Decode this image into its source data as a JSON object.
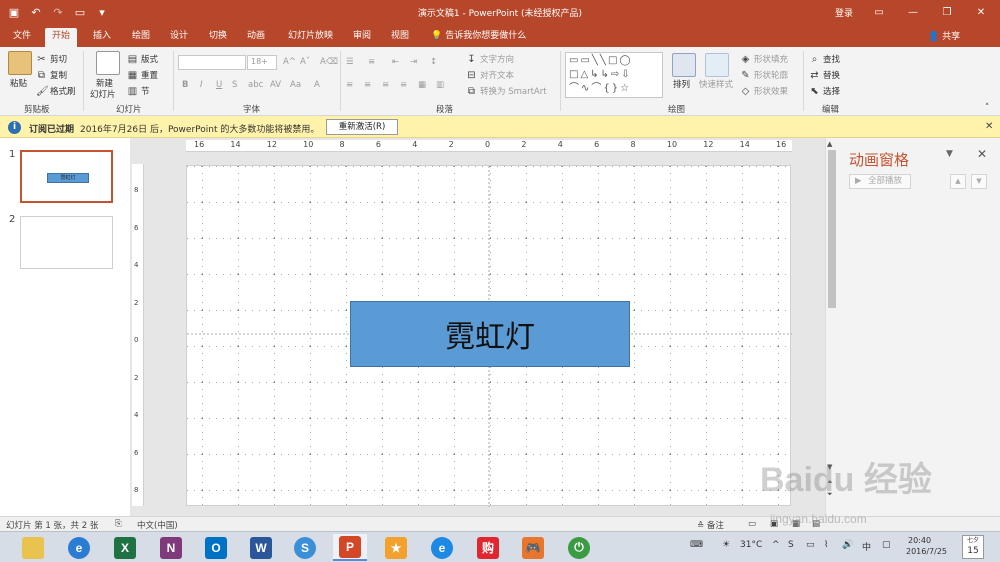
{
  "app": {
    "title": "演示文稿1 - PowerPoint (未经授权产品)",
    "signin": "登录",
    "share": "共享"
  },
  "tabs": [
    {
      "label": "文件"
    },
    {
      "label": "开始"
    },
    {
      "label": "插入"
    },
    {
      "label": "绘图"
    },
    {
      "label": "设计"
    },
    {
      "label": "切换"
    },
    {
      "label": "动画"
    },
    {
      "label": "幻灯片放映"
    },
    {
      "label": "审阅"
    },
    {
      "label": "视图"
    }
  ],
  "tell_me": "告诉我你想要做什么",
  "ribbon": {
    "clipboard": {
      "paste": "粘贴",
      "cut": "剪切",
      "copy": "复制",
      "format_painter": "格式刷",
      "label": "剪贴板"
    },
    "slides": {
      "new_slide": "新建",
      "new_slide2": "幻灯片",
      "layout": "版式",
      "reset": "重置",
      "section": "节",
      "label": "幻灯片"
    },
    "font": {
      "size_value": "18+",
      "label": "字体"
    },
    "paragraph": {
      "text_direction": "文字方向",
      "align_text": "对齐文本",
      "convert_smartart": "转换为 SmartArt",
      "label": "段落"
    },
    "drawing": {
      "arrange": "排列",
      "quick_styles": "快速样式",
      "shape_fill": "形状填充",
      "shape_outline": "形状轮廓",
      "shape_effects": "形状效果",
      "label": "绘图"
    },
    "editing": {
      "find": "查找",
      "replace": "替换",
      "select": "选择",
      "label": "编辑"
    }
  },
  "message_bar": {
    "title": "订阅已过期",
    "text": "2016年7月26日 后，PowerPoint 的大多数功能将被禁用。",
    "button": "重新激活(R)"
  },
  "thumbnails": [
    {
      "number": "1",
      "text": "霓虹灯"
    },
    {
      "number": "2",
      "text": ""
    }
  ],
  "ruler": {
    "h_ticks": [
      "16",
      "14",
      "12",
      "10",
      "8",
      "6",
      "4",
      "2",
      "0",
      "2",
      "4",
      "6",
      "8",
      "10",
      "12",
      "14",
      "16"
    ],
    "v_ticks": [
      "8",
      "6",
      "4",
      "2",
      "0",
      "2",
      "4",
      "6",
      "8"
    ]
  },
  "slide": {
    "shape_text": "霓虹灯",
    "shape_color": "#5b9bd5"
  },
  "anim_pane": {
    "title": "动画窗格",
    "play_all": "全部播放"
  },
  "status": {
    "slide_info": "幻灯片 第 1 张，共 2 张",
    "language": "中文(中国)",
    "notes": "备注"
  },
  "taskbar": {
    "weather": "31°C",
    "time": "20:40",
    "date": "2016/7/25",
    "cal_day": "15",
    "cal_label": "七夕",
    "ime": "中",
    "watermark": "Baidu 经验",
    "watermark_url": "jingyan.baidu.com"
  },
  "colors": {
    "accent": "#b7472a",
    "shape": "#5b9bd5"
  }
}
